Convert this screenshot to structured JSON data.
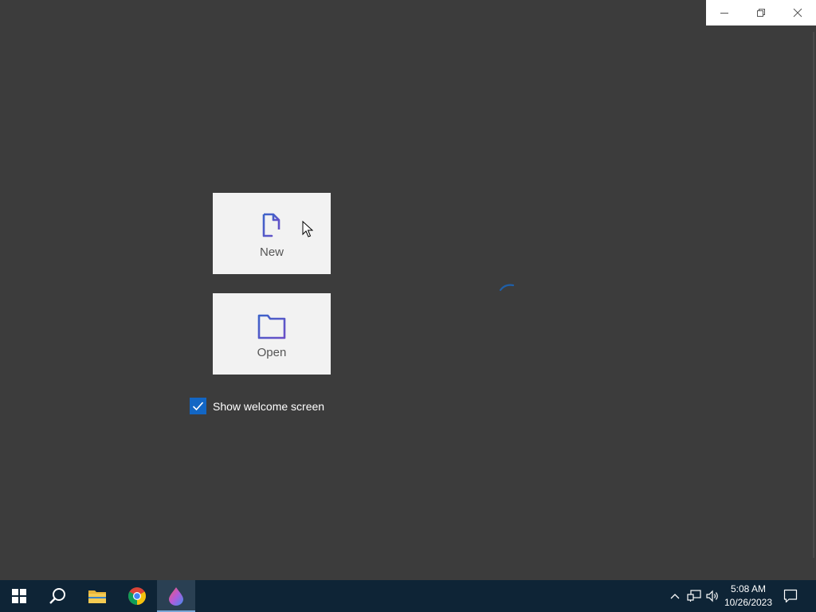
{
  "window": {
    "minimize_icon": "minimize-icon",
    "restore_icon": "restore-icon",
    "close_icon": "close-icon"
  },
  "welcome": {
    "new_label": "New",
    "open_label": "Open",
    "show_welcome_label": "Show welcome screen",
    "show_welcome_checked": true,
    "accent_color": "#1266c4"
  },
  "taskbar": {
    "items": [
      {
        "name": "start-button",
        "icon": "windows-logo-icon"
      },
      {
        "name": "search-button",
        "icon": "search-icon"
      },
      {
        "name": "file-explorer",
        "icon": "folder-icon"
      },
      {
        "name": "chrome",
        "icon": "chrome-icon"
      },
      {
        "name": "paint-app",
        "icon": "paint-drop-icon",
        "active": true
      }
    ],
    "clock": {
      "time": "5:08 AM",
      "date": "10/26/2023"
    },
    "tray_icons": [
      "chevron-up-icon",
      "network-icon",
      "volume-icon",
      "notification-icon"
    ]
  }
}
